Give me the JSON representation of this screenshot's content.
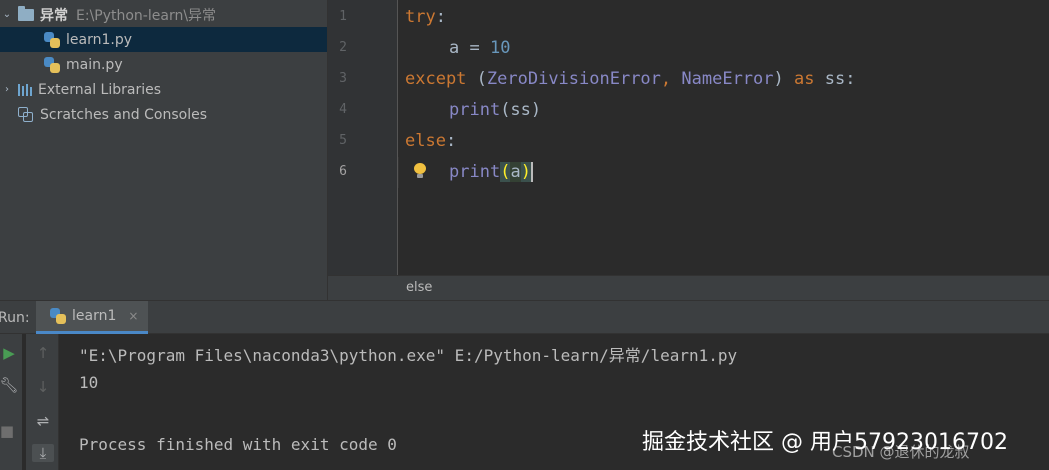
{
  "project_tree": {
    "root_folder": {
      "name": "异常",
      "path": "E:\\Python-learn\\异常"
    },
    "files": [
      {
        "name": "learn1.py",
        "selected": true
      },
      {
        "name": "main.py",
        "selected": false
      }
    ],
    "external_libraries": "External Libraries",
    "scratches": "Scratches and Consoles"
  },
  "editor": {
    "line_numbers": [
      "1",
      "2",
      "3",
      "4",
      "5",
      "6"
    ],
    "current_line": 6,
    "code": {
      "l1_kw": "try",
      "l1_colon": ":",
      "l2_text": "a = ",
      "l2_num": "10",
      "l3_kw_except": "except",
      "l3_open": " (",
      "l3_err1": "ZeroDivisionError",
      "l3_comma": ", ",
      "l3_err2": "NameError",
      "l3_close": ") ",
      "l3_kw_as": "as",
      "l3_tail": " ss:",
      "l4_fn": "print",
      "l4_args": "(ss)",
      "l5_kw": "else",
      "l5_colon": ":",
      "l6_fn": "print",
      "l6_open": "(",
      "l6_arg": "a",
      "l6_close": ")"
    },
    "breadcrumb": "else"
  },
  "run": {
    "label": "Run:",
    "tab_label": "learn1",
    "tab_close": "×",
    "console_lines": [
      "\"E:\\Program Files\\naconda3\\python.exe\" E:/Python-learn/异常/learn1.py",
      "10",
      "",
      "Process finished with exit code 0"
    ]
  },
  "watermarks": {
    "primary": "掘金技术社区 @ 用户57923016702",
    "secondary": "CSDN @退休的龙叔"
  },
  "colors": {
    "keyword": "#cc7832",
    "number": "#6897bb",
    "builtin": "#8888c6",
    "selection": "#0d293e",
    "accent": "#4a88c7"
  }
}
